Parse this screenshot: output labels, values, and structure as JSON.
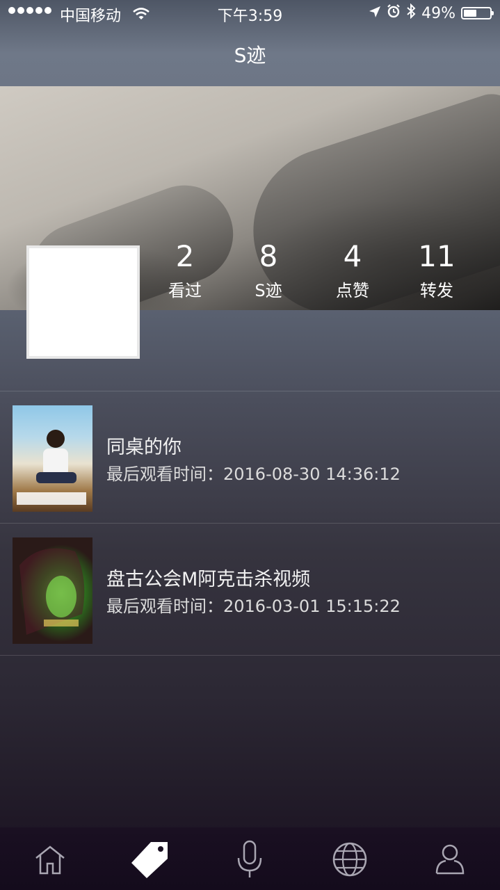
{
  "status_bar": {
    "carrier": "中国移动",
    "time": "下午3:59",
    "battery": "49%",
    "battery_level": 0.49,
    "icons": [
      "signal-dots-icon",
      "wifi-icon",
      "location-arrow-icon",
      "alarm-icon",
      "bluetooth-icon",
      "battery-icon"
    ]
  },
  "nav": {
    "title": "S迹"
  },
  "profile": {
    "stats": [
      {
        "value": "2",
        "label": "看过"
      },
      {
        "value": "8",
        "label": "S迹"
      },
      {
        "value": "4",
        "label": "点赞"
      },
      {
        "value": "11",
        "label": "转发"
      }
    ]
  },
  "history": [
    {
      "title": "同桌的你",
      "meta": "最后观看时间：2016-08-30 14:36:12"
    },
    {
      "title": "盘古公会M阿克击杀视频",
      "meta": "最后观看时间：2016-03-01 15:15:22"
    }
  ],
  "tabbar": {
    "items": [
      {
        "icon": "home-icon",
        "active": false
      },
      {
        "icon": "tag-icon",
        "active": true
      },
      {
        "icon": "microphone-icon",
        "active": false
      },
      {
        "icon": "globe-icon",
        "active": false
      },
      {
        "icon": "user-icon",
        "active": false
      }
    ],
    "colors": {
      "active": "#ffffff",
      "inactive": "#a9a6b2"
    }
  }
}
